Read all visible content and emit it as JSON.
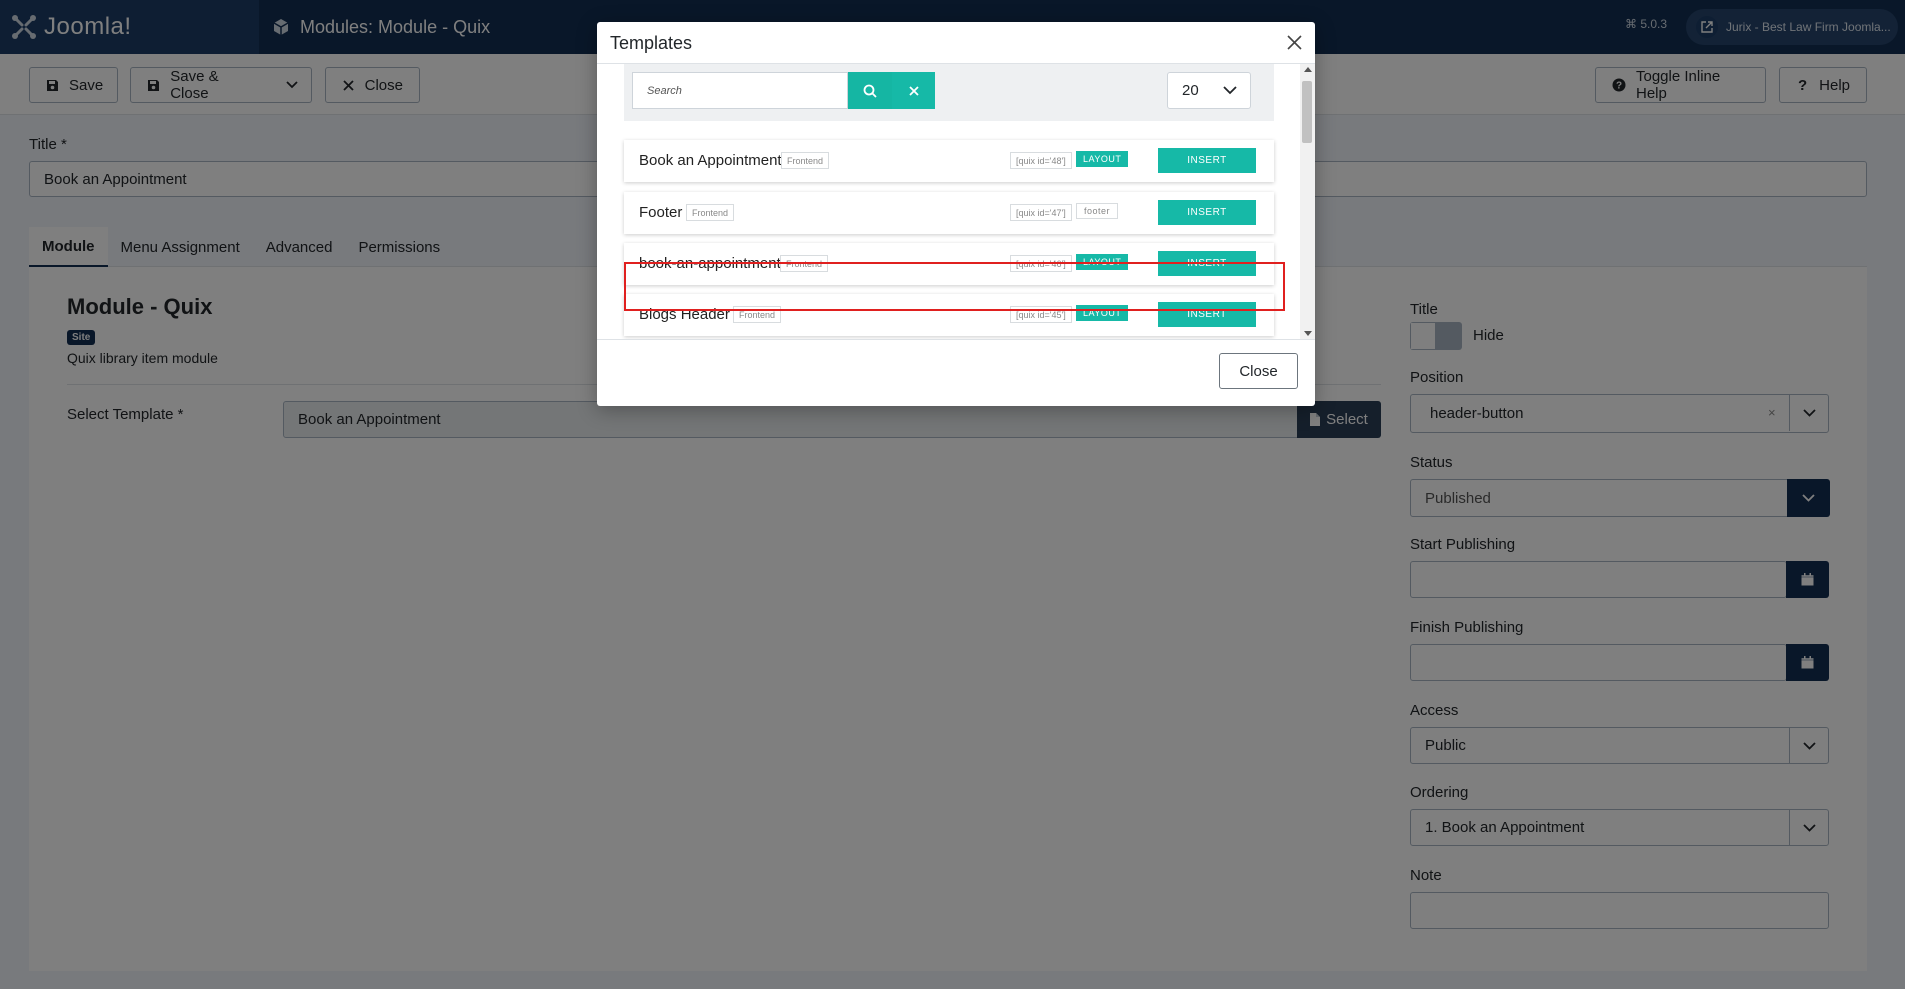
{
  "header": {
    "brand_name": "Joomla!",
    "page_title": "Modules: Module - Quix",
    "version": "⌘ 5.0.3",
    "site_link": "Jurix - Best Law Firm Joomla..."
  },
  "toolbar": {
    "save": "Save",
    "save_close": "Save & Close",
    "close": "Close",
    "toggle_inline_help": "Toggle Inline Help",
    "help": "Help"
  },
  "form": {
    "title_label": "Title *",
    "title_value": "Book an Appointment"
  },
  "tabs": [
    "Module",
    "Menu Assignment",
    "Advanced",
    "Permissions"
  ],
  "module": {
    "heading": "Module - Quix",
    "badge": "Site",
    "description": "Quix library item module",
    "select_template_label": "Select Template *",
    "select_template_value": "Book an Appointment",
    "select_button": "Select"
  },
  "sidebar": {
    "title_label": "Title",
    "title_toggle": "Hide",
    "position_label": "Position",
    "position_value": "header-button",
    "position_clear": "×",
    "status_label": "Status",
    "status_value": "Published",
    "start_label": "Start Publishing",
    "start_value": "",
    "finish_label": "Finish Publishing",
    "finish_value": "",
    "access_label": "Access",
    "access_value": "Public",
    "ordering_label": "Ordering",
    "ordering_value": "1. Book an Appointment",
    "note_label": "Note",
    "note_value": ""
  },
  "modal": {
    "title": "Templates",
    "search_placeholder": "Search",
    "per_page": "20",
    "close_button": "Close",
    "items": [
      {
        "name": "Book an Appointment",
        "tag": "Frontend",
        "code": "[quix id='48']",
        "type": "LAYOUT",
        "insert": "INSERT"
      },
      {
        "name": "Footer",
        "tag": "Frontend",
        "code": "[quix id='47']",
        "type": "footer",
        "insert": "INSERT"
      },
      {
        "name": "book-an-appointment",
        "tag": "Frontend",
        "code": "[quix id='46']",
        "type": "LAYOUT",
        "insert": "INSERT"
      },
      {
        "name": "Blogs Header",
        "tag": "Frontend",
        "code": "[quix id='45']",
        "type": "LAYOUT",
        "insert": "INSERT"
      }
    ]
  },
  "colors": {
    "header_bg": "#132f53",
    "accent_teal": "#16b9a7",
    "highlight_red": "#e0201f"
  }
}
